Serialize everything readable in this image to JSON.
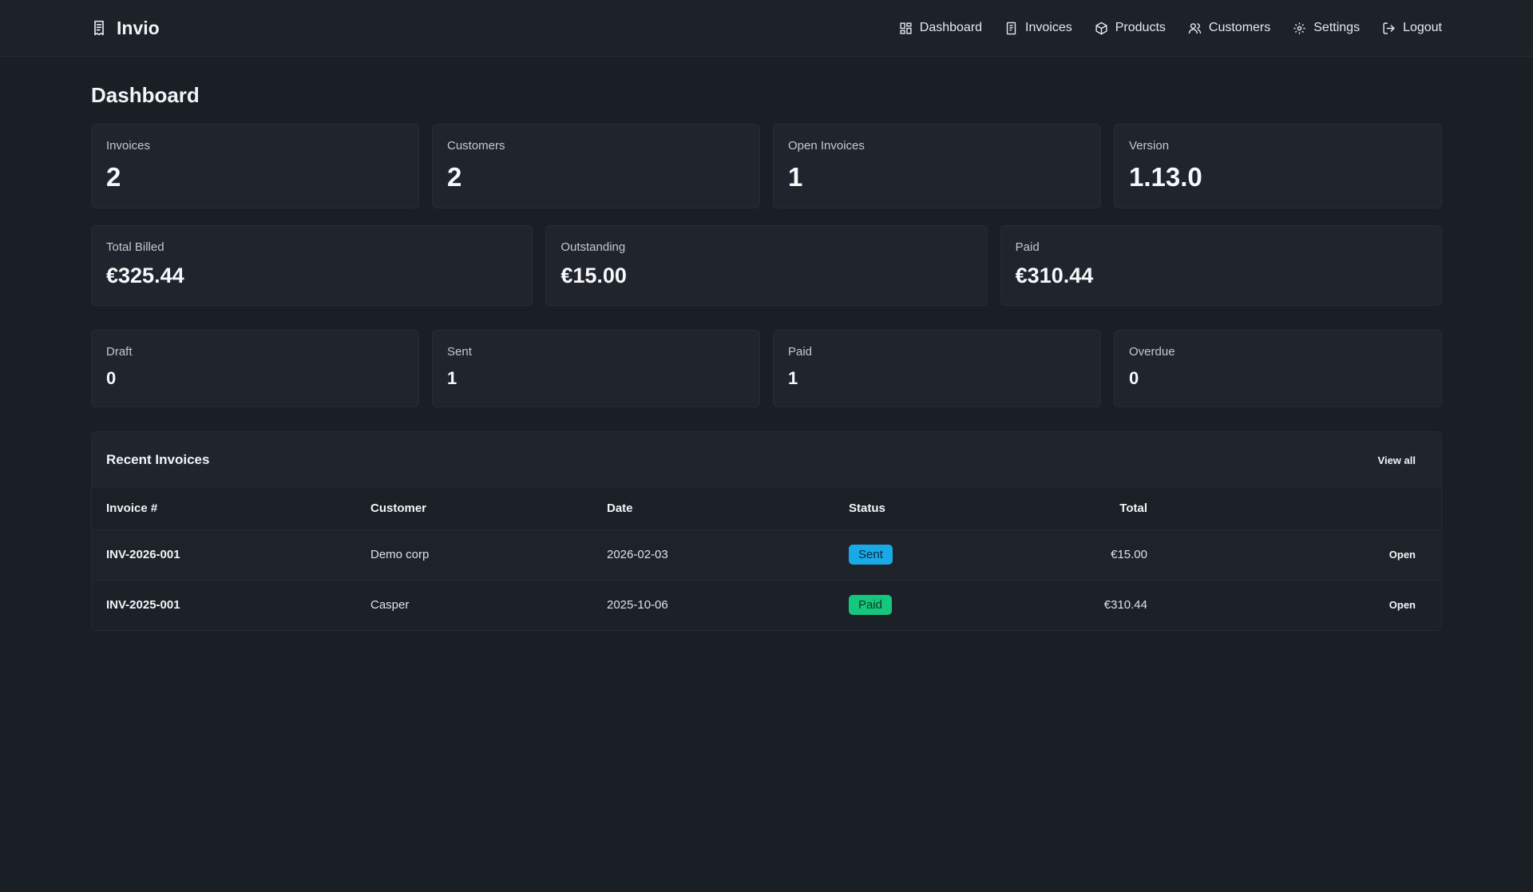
{
  "app": {
    "name": "Invio"
  },
  "nav": {
    "dashboard": "Dashboard",
    "invoices": "Invoices",
    "products": "Products",
    "customers": "Customers",
    "settings": "Settings",
    "logout": "Logout"
  },
  "page": {
    "title": "Dashboard"
  },
  "stats_top": [
    {
      "label": "Invoices",
      "value": "2"
    },
    {
      "label": "Customers",
      "value": "2"
    },
    {
      "label": "Open Invoices",
      "value": "1"
    },
    {
      "label": "Version",
      "value": "1.13.0"
    }
  ],
  "stats_money": [
    {
      "label": "Total Billed",
      "value": "€325.44"
    },
    {
      "label": "Outstanding",
      "value": "€15.00"
    },
    {
      "label": "Paid",
      "value": "€310.44"
    }
  ],
  "stats_status": [
    {
      "label": "Draft",
      "value": "0"
    },
    {
      "label": "Sent",
      "value": "1"
    },
    {
      "label": "Paid",
      "value": "1"
    },
    {
      "label": "Overdue",
      "value": "0"
    }
  ],
  "recent": {
    "title": "Recent Invoices",
    "view_all": "View all",
    "columns": {
      "invoice": "Invoice #",
      "customer": "Customer",
      "date": "Date",
      "status": "Status",
      "total": "Total"
    },
    "rows": [
      {
        "invoice": "INV-2026-001",
        "customer": "Demo corp",
        "date": "2026-02-03",
        "status": "Sent",
        "total": "€15.00",
        "action": "Open"
      },
      {
        "invoice": "INV-2025-001",
        "customer": "Casper",
        "date": "2025-10-06",
        "status": "Paid",
        "total": "€310.44",
        "action": "Open"
      }
    ]
  },
  "colors": {
    "background": "#1a1e25",
    "card": "#20252d",
    "sent_badge": "#1aa9e8",
    "paid_badge": "#14c77d"
  },
  "icons": [
    "receipt-icon",
    "dashboard-icon",
    "invoice-icon",
    "box-icon",
    "users-icon",
    "gear-icon",
    "logout-icon"
  ]
}
